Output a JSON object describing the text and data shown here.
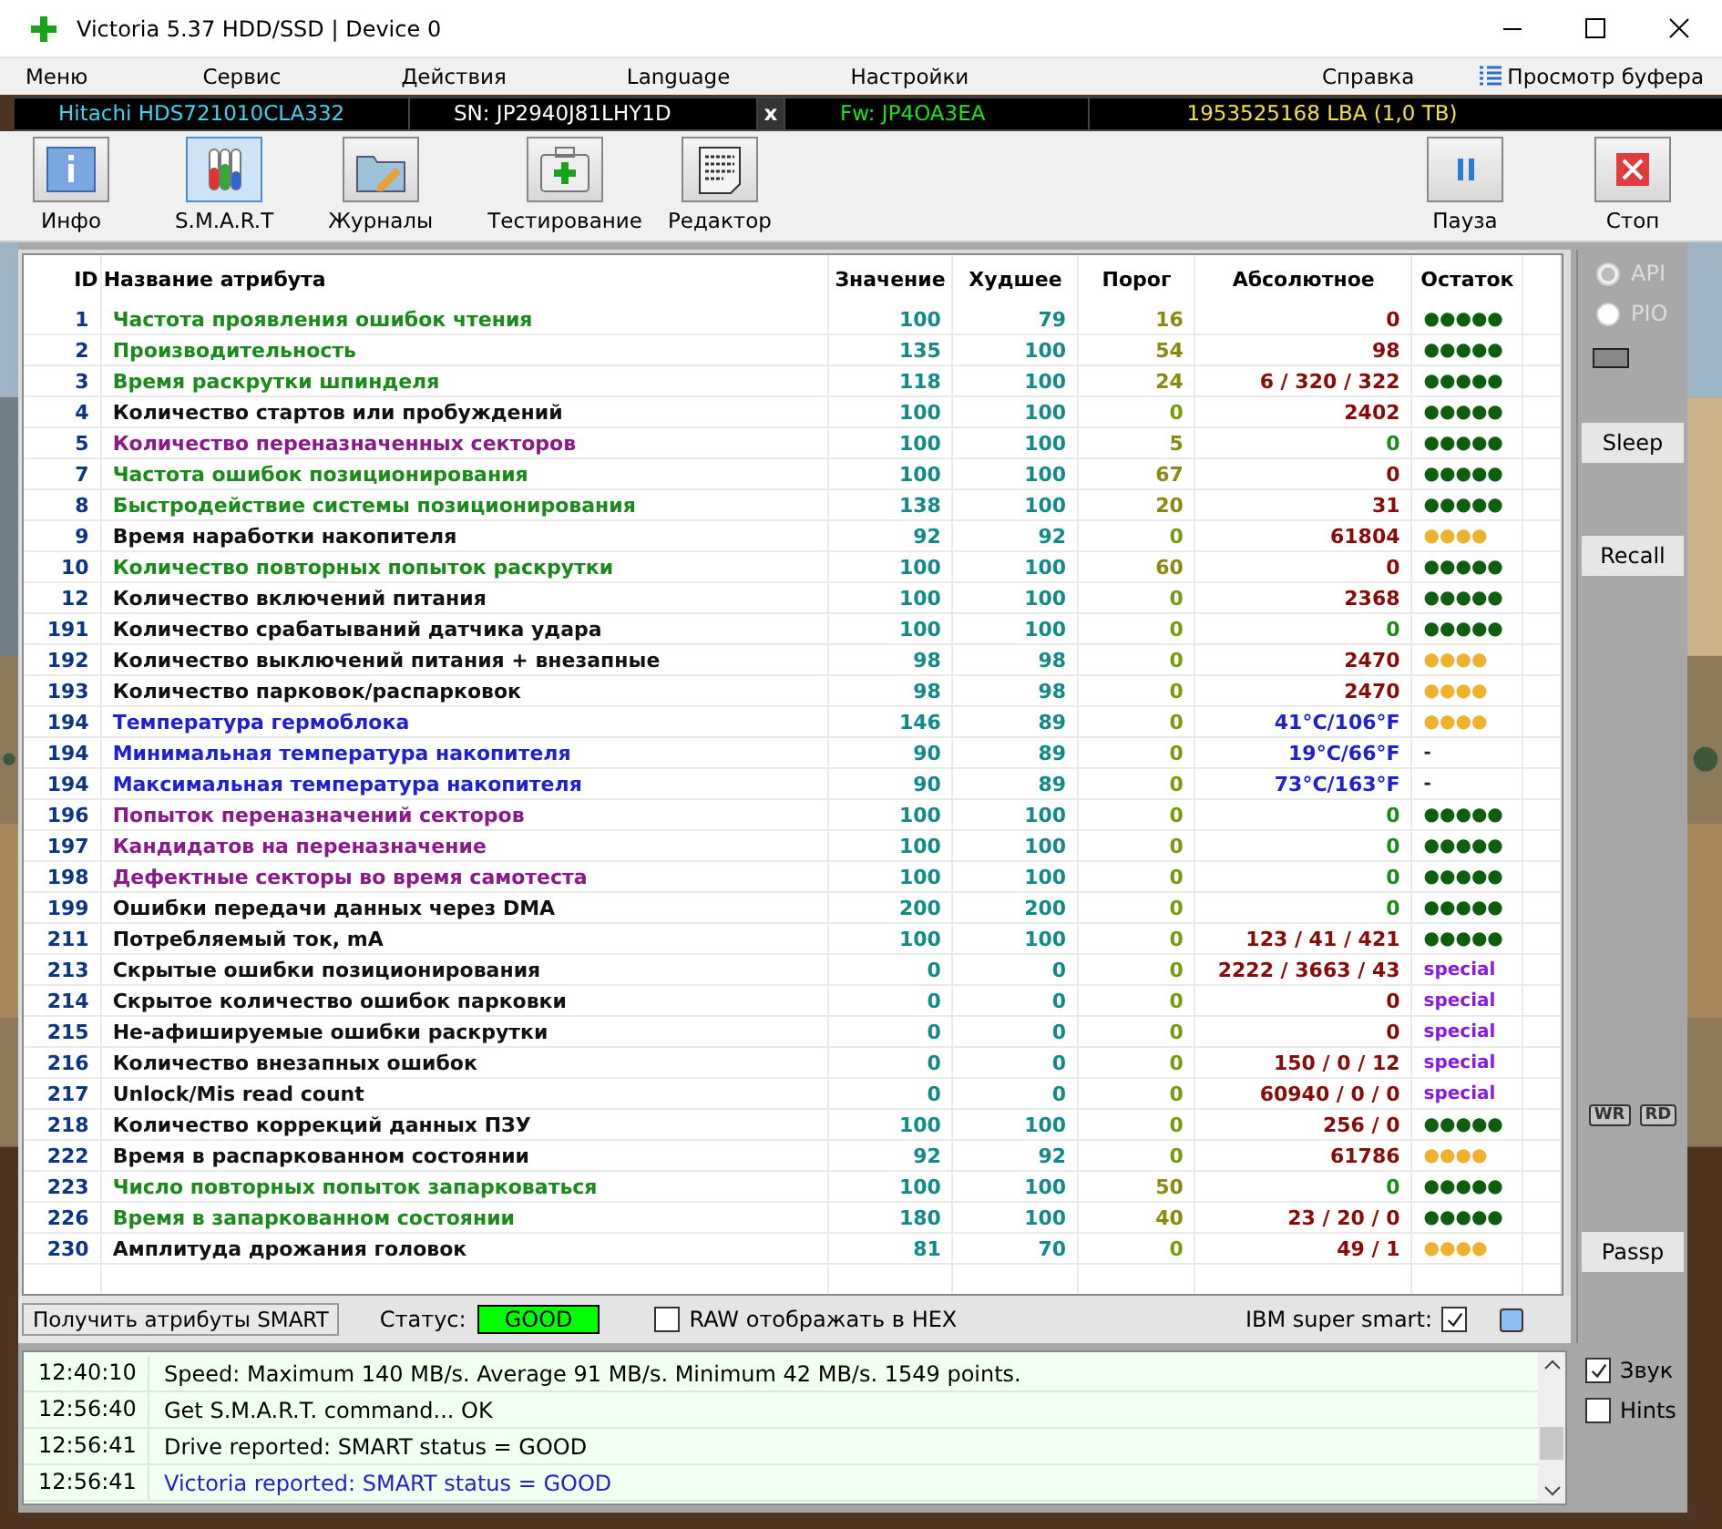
{
  "window": {
    "title": "Victoria 5.37 HDD/SSD | Device 0"
  },
  "menu": [
    {
      "label": "Меню"
    },
    {
      "label": "Сервис"
    },
    {
      "label": "Действия"
    },
    {
      "label": "Language"
    },
    {
      "label": "Настройки"
    },
    {
      "label": "Справка"
    }
  ],
  "buffer_view": "Просмотр буфера",
  "drive": {
    "model": "Hitachi HDS721010CLA332",
    "serial": "SN: JP2940J81LHY1D",
    "close": "x",
    "firmware": "Fw: JP4OA3EA",
    "capacity": "1953525168 LBA (1,0 TB)"
  },
  "toolbar": [
    {
      "label": "Инфо",
      "kind": "info",
      "selected": false
    },
    {
      "label": "S.M.A.R.T",
      "kind": "smart",
      "selected": true
    },
    {
      "label": "Журналы",
      "kind": "logs",
      "selected": false
    },
    {
      "label": "Тестирование",
      "kind": "test",
      "selected": false
    },
    {
      "label": "Редактор",
      "kind": "editor",
      "selected": false
    }
  ],
  "toolbar_right": [
    {
      "label": "Пауза",
      "kind": "pause"
    },
    {
      "label": "Стоп",
      "kind": "stop"
    }
  ],
  "table": {
    "columns": [
      "ID",
      "Название атрибута",
      "Значение",
      "Худшее",
      "Порог",
      "Абсолютное",
      "Остаток"
    ],
    "rows": [
      {
        "id": "1",
        "name": {
          "text": "Частота проявления ошибок чтения",
          "color": "#1a8a1a"
        },
        "value": "100",
        "worst": "79",
        "threshold": {
          "text": "16",
          "color": "#8a8a10"
        },
        "raw": {
          "text": "0",
          "color": "#8a0a0a"
        },
        "remaining": {
          "text": "●●●●●",
          "color": "#0d5f0d"
        }
      },
      {
        "id": "2",
        "name": {
          "text": "Производительность",
          "color": "#1a8a1a"
        },
        "value": "135",
        "worst": "100",
        "threshold": {
          "text": "54",
          "color": "#8a8a10"
        },
        "raw": {
          "text": "98",
          "color": "#8a0a0a"
        },
        "remaining": {
          "text": "●●●●●",
          "color": "#0d5f0d"
        }
      },
      {
        "id": "3",
        "name": {
          "text": "Время раскрутки шпинделя",
          "color": "#1a8a1a"
        },
        "value": "118",
        "worst": "100",
        "threshold": {
          "text": "24",
          "color": "#8a8a10"
        },
        "raw": {
          "text": "6 / 320 / 322",
          "color": "#8a0a0a"
        },
        "remaining": {
          "text": "●●●●●",
          "color": "#0d5f0d"
        }
      },
      {
        "id": "4",
        "name": {
          "text": "Количество стартов или пробуждений",
          "color": "#111111"
        },
        "value": "100",
        "worst": "100",
        "threshold": {
          "text": "0",
          "color": "#7a9a10"
        },
        "raw": {
          "text": "2402",
          "color": "#8a0a0a"
        },
        "remaining": {
          "text": "●●●●●",
          "color": "#0d5f0d"
        }
      },
      {
        "id": "5",
        "name": {
          "text": "Количество переназначенных секторов",
          "color": "#8a1a8a"
        },
        "value": "100",
        "worst": "100",
        "threshold": {
          "text": "5",
          "color": "#8a8a10"
        },
        "raw": {
          "text": "0",
          "color": "#1a8a1a"
        },
        "remaining": {
          "text": "●●●●●",
          "color": "#0d5f0d"
        }
      },
      {
        "id": "7",
        "name": {
          "text": "Частота ошибок позиционирования",
          "color": "#1a8a1a"
        },
        "value": "100",
        "worst": "100",
        "threshold": {
          "text": "67",
          "color": "#8a8a10"
        },
        "raw": {
          "text": "0",
          "color": "#8a0a0a"
        },
        "remaining": {
          "text": "●●●●●",
          "color": "#0d5f0d"
        }
      },
      {
        "id": "8",
        "name": {
          "text": "Быстродействие системы позиционирования",
          "color": "#1a8a1a"
        },
        "value": "138",
        "worst": "100",
        "threshold": {
          "text": "20",
          "color": "#8a8a10"
        },
        "raw": {
          "text": "31",
          "color": "#8a0a0a"
        },
        "remaining": {
          "text": "●●●●●",
          "color": "#0d5f0d"
        }
      },
      {
        "id": "9",
        "name": {
          "text": "Время наработки накопителя",
          "color": "#111111"
        },
        "value": "92",
        "worst": "92",
        "threshold": {
          "text": "0",
          "color": "#7a9a10"
        },
        "raw": {
          "text": "61804",
          "color": "#8a0a0a"
        },
        "remaining": {
          "text": "●●●●",
          "color": "#f0b030"
        }
      },
      {
        "id": "10",
        "name": {
          "text": "Количество повторных попыток раскрутки",
          "color": "#1a8a1a"
        },
        "value": "100",
        "worst": "100",
        "threshold": {
          "text": "60",
          "color": "#8a8a10"
        },
        "raw": {
          "text": "0",
          "color": "#8a0a0a"
        },
        "remaining": {
          "text": "●●●●●",
          "color": "#0d5f0d"
        }
      },
      {
        "id": "12",
        "name": {
          "text": "Количество включений питания",
          "color": "#111111"
        },
        "value": "100",
        "worst": "100",
        "threshold": {
          "text": "0",
          "color": "#7a9a10"
        },
        "raw": {
          "text": "2368",
          "color": "#8a0a0a"
        },
        "remaining": {
          "text": "●●●●●",
          "color": "#0d5f0d"
        }
      },
      {
        "id": "191",
        "name": {
          "text": "Количество срабатываний датчика удара",
          "color": "#111111"
        },
        "value": "100",
        "worst": "100",
        "threshold": {
          "text": "0",
          "color": "#7a9a10"
        },
        "raw": {
          "text": "0",
          "color": "#1a8a1a"
        },
        "remaining": {
          "text": "●●●●●",
          "color": "#0d5f0d"
        }
      },
      {
        "id": "192",
        "name": {
          "text": "Количество выключений питания + внезапные",
          "color": "#111111"
        },
        "value": "98",
        "worst": "98",
        "threshold": {
          "text": "0",
          "color": "#7a9a10"
        },
        "raw": {
          "text": "2470",
          "color": "#8a0a0a"
        },
        "remaining": {
          "text": "●●●●",
          "color": "#f0b030"
        }
      },
      {
        "id": "193",
        "name": {
          "text": "Количество парковок/распарковок",
          "color": "#111111"
        },
        "value": "98",
        "worst": "98",
        "threshold": {
          "text": "0",
          "color": "#7a9a10"
        },
        "raw": {
          "text": "2470",
          "color": "#8a0a0a"
        },
        "remaining": {
          "text": "●●●●",
          "color": "#f0b030"
        }
      },
      {
        "id": "194",
        "name": {
          "text": "Температура гермоблока",
          "color": "#2020d0"
        },
        "value": "146",
        "worst": "89",
        "threshold": {
          "text": "0",
          "color": "#7a9a10"
        },
        "raw": {
          "text": "41°C/106°F",
          "color": "#2020d0"
        },
        "remaining": {
          "text": "●●●●",
          "color": "#f0b030"
        }
      },
      {
        "id": "194",
        "name": {
          "text": "Минимальная температура накопителя",
          "color": "#2020d0"
        },
        "value": "90",
        "worst": "89",
        "threshold": {
          "text": "0",
          "color": "#7a9a10"
        },
        "raw": {
          "text": "19°C/66°F",
          "color": "#2020d0"
        },
        "remaining": {
          "text": "-",
          "color": "#222222"
        }
      },
      {
        "id": "194",
        "name": {
          "text": "Максимальная температура накопителя",
          "color": "#2020d0"
        },
        "value": "90",
        "worst": "89",
        "threshold": {
          "text": "0",
          "color": "#7a9a10"
        },
        "raw": {
          "text": "73°C/163°F",
          "color": "#2020d0"
        },
        "remaining": {
          "text": "-",
          "color": "#222222"
        }
      },
      {
        "id": "196",
        "name": {
          "text": "Попыток переназначений секторов",
          "color": "#8a1a8a"
        },
        "value": "100",
        "worst": "100",
        "threshold": {
          "text": "0",
          "color": "#7a9a10"
        },
        "raw": {
          "text": "0",
          "color": "#1a8a1a"
        },
        "remaining": {
          "text": "●●●●●",
          "color": "#0d5f0d"
        }
      },
      {
        "id": "197",
        "name": {
          "text": "Кандидатов на переназначение",
          "color": "#8a1a8a"
        },
        "value": "100",
        "worst": "100",
        "threshold": {
          "text": "0",
          "color": "#7a9a10"
        },
        "raw": {
          "text": "0",
          "color": "#1a8a1a"
        },
        "remaining": {
          "text": "●●●●●",
          "color": "#0d5f0d"
        }
      },
      {
        "id": "198",
        "name": {
          "text": "Дефектные секторы во время самотеста",
          "color": "#8a1a8a"
        },
        "value": "100",
        "worst": "100",
        "threshold": {
          "text": "0",
          "color": "#7a9a10"
        },
        "raw": {
          "text": "0",
          "color": "#1a8a1a"
        },
        "remaining": {
          "text": "●●●●●",
          "color": "#0d5f0d"
        }
      },
      {
        "id": "199",
        "name": {
          "text": "Ошибки передачи данных через DMA",
          "color": "#111111"
        },
        "value": "200",
        "worst": "200",
        "threshold": {
          "text": "0",
          "color": "#7a9a10"
        },
        "raw": {
          "text": "0",
          "color": "#1a8a1a"
        },
        "remaining": {
          "text": "●●●●●",
          "color": "#0d5f0d"
        }
      },
      {
        "id": "211",
        "name": {
          "text": "Потребляемый ток, mA",
          "color": "#111111"
        },
        "value": "100",
        "worst": "100",
        "threshold": {
          "text": "0",
          "color": "#7a9a10"
        },
        "raw": {
          "text": "123 / 41 / 421",
          "color": "#8a0a0a"
        },
        "remaining": {
          "text": "●●●●●",
          "color": "#0d5f0d"
        }
      },
      {
        "id": "213",
        "name": {
          "text": "Скрытые ошибки позиционирования",
          "color": "#111111"
        },
        "value": "0",
        "worst": "0",
        "threshold": {
          "text": "0",
          "color": "#7a9a10"
        },
        "raw": {
          "text": "2222 / 3663 / 43",
          "color": "#8a0a0a"
        },
        "remaining": {
          "text": "special",
          "color": "#8a1ae0"
        }
      },
      {
        "id": "214",
        "name": {
          "text": "Скрытое количество ошибок парковки",
          "color": "#111111"
        },
        "value": "0",
        "worst": "0",
        "threshold": {
          "text": "0",
          "color": "#7a9a10"
        },
        "raw": {
          "text": "0",
          "color": "#8a0a0a"
        },
        "remaining": {
          "text": "special",
          "color": "#8a1ae0"
        }
      },
      {
        "id": "215",
        "name": {
          "text": "Не-афишируемые ошибки раскрутки",
          "color": "#111111"
        },
        "value": "0",
        "worst": "0",
        "threshold": {
          "text": "0",
          "color": "#7a9a10"
        },
        "raw": {
          "text": "0",
          "color": "#8a0a0a"
        },
        "remaining": {
          "text": "special",
          "color": "#8a1ae0"
        }
      },
      {
        "id": "216",
        "name": {
          "text": "Количество внезапных ошибок",
          "color": "#111111"
        },
        "value": "0",
        "worst": "0",
        "threshold": {
          "text": "0",
          "color": "#7a9a10"
        },
        "raw": {
          "text": "150 / 0 / 12",
          "color": "#8a0a0a"
        },
        "remaining": {
          "text": "special",
          "color": "#8a1ae0"
        }
      },
      {
        "id": "217",
        "name": {
          "text": "Unlock/Mis read count",
          "color": "#111111"
        },
        "value": "0",
        "worst": "0",
        "threshold": {
          "text": "0",
          "color": "#7a9a10"
        },
        "raw": {
          "text": "60940 / 0 / 0",
          "color": "#8a0a0a"
        },
        "remaining": {
          "text": "special",
          "color": "#8a1ae0"
        }
      },
      {
        "id": "218",
        "name": {
          "text": "Количество коррекций данных ПЗУ",
          "color": "#111111"
        },
        "value": "100",
        "worst": "100",
        "threshold": {
          "text": "0",
          "color": "#7a9a10"
        },
        "raw": {
          "text": "256 / 0",
          "color": "#8a0a0a"
        },
        "remaining": {
          "text": "●●●●●",
          "color": "#0d5f0d"
        }
      },
      {
        "id": "222",
        "name": {
          "text": "Время в распаркованном состоянии",
          "color": "#111111"
        },
        "value": "92",
        "worst": "92",
        "threshold": {
          "text": "0",
          "color": "#7a9a10"
        },
        "raw": {
          "text": "61786",
          "color": "#8a0a0a"
        },
        "remaining": {
          "text": "●●●●",
          "color": "#f0b030"
        }
      },
      {
        "id": "223",
        "name": {
          "text": "Число повторных попыток запарковаться",
          "color": "#1a8a1a"
        },
        "value": "100",
        "worst": "100",
        "threshold": {
          "text": "50",
          "color": "#8a8a10"
        },
        "raw": {
          "text": "0",
          "color": "#1a8a1a"
        },
        "remaining": {
          "text": "●●●●●",
          "color": "#0d5f0d"
        }
      },
      {
        "id": "226",
        "name": {
          "text": "Время в запаркованном состоянии",
          "color": "#1a8a1a"
        },
        "value": "180",
        "worst": "100",
        "threshold": {
          "text": "40",
          "color": "#8a8a10"
        },
        "raw": {
          "text": "23 / 20 / 0",
          "color": "#8a0a0a"
        },
        "remaining": {
          "text": "●●●●●",
          "color": "#0d5f0d"
        }
      },
      {
        "id": "230",
        "name": {
          "text": "Амплитуда дрожания головок",
          "color": "#111111"
        },
        "value": "81",
        "worst": "70",
        "threshold": {
          "text": "0",
          "color": "#7a9a10"
        },
        "raw": {
          "text": "49 / 1",
          "color": "#8a0a0a"
        },
        "remaining": {
          "text": "●●●●",
          "color": "#f0b030"
        }
      }
    ]
  },
  "smart_bar": {
    "button": "Получить атрибуты SMART",
    "status_label": "Статус:",
    "status": "GOOD",
    "raw_hex": {
      "label": "RAW отображать в HEX",
      "checked": false
    },
    "ibm": {
      "label": "IBM super smart:",
      "checked": true
    }
  },
  "side_panel": {
    "modes": [
      {
        "label": "API",
        "selected": true,
        "disabled": true
      },
      {
        "label": "PIO",
        "selected": false,
        "disabled": true
      }
    ],
    "buttons": [
      "Sleep",
      "Recall"
    ],
    "indicators": [
      "WR",
      "RD"
    ],
    "passp": "Passp"
  },
  "log": [
    {
      "time": "12:40:10",
      "message": "Speed: Maximum 140 MB/s. Average 91 MB/s. Minimum 42 MB/s. 1549 points.",
      "kind": "normal"
    },
    {
      "time": "12:56:40",
      "message": "Get S.M.A.R.T. command... OK",
      "kind": "normal"
    },
    {
      "time": "12:56:41",
      "message": "Drive reported: SMART status = GOOD",
      "kind": "normal"
    },
    {
      "time": "12:56:41",
      "message": "Victoria reported: SMART status = GOOD",
      "kind": "victoria"
    }
  ],
  "options": [
    {
      "label": "Звук",
      "checked": true
    },
    {
      "label": "Hints",
      "checked": false
    }
  ]
}
